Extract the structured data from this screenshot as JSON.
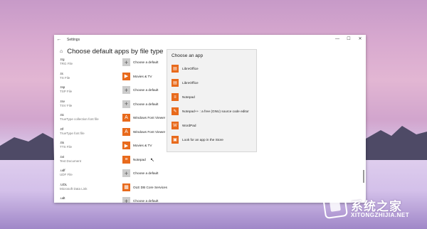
{
  "window": {
    "title": "Settings",
    "back_icon": "back-arrow-icon",
    "minimize": "—",
    "maximize": "☐",
    "close": "✕"
  },
  "heading": {
    "icon": "home-icon",
    "text": "Choose default apps by file type"
  },
  "rows": [
    {
      "ext": ".trg",
      "desc": "TRG File",
      "app": "Choose a default",
      "icon": "plus"
    },
    {
      "ext": ".ts",
      "desc": "TS File",
      "app": "Movies & TV",
      "icon": "app"
    },
    {
      "ext": ".tsp",
      "desc": "TSP File",
      "app": "Choose a default",
      "icon": "plus"
    },
    {
      "ext": ".tsv",
      "desc": "TSV File",
      "app": "Choose a default",
      "icon": "plus"
    },
    {
      "ext": ".ttc",
      "desc": "TrueType collection font file",
      "app": "Windows Font Viewer",
      "icon": "app"
    },
    {
      "ext": ".ttf",
      "desc": "TrueType font file",
      "app": "Windows Font Viewer",
      "icon": "app"
    },
    {
      "ext": ".tts",
      "desc": "TTS File",
      "app": "Movies & TV",
      "icon": "app"
    },
    {
      "ext": ".txt",
      "desc": "Text Document",
      "app": "Notepad",
      "icon": "app"
    },
    {
      "ext": ".udf",
      "desc": "UDF File",
      "app": "Choose a default",
      "icon": "plus"
    },
    {
      "ext": ".UDL",
      "desc": "Microsoft Data Link",
      "app": "OLE DB Core Services",
      "icon": "app"
    },
    {
      "ext": ".udt",
      "desc": "",
      "app": "Choose a default",
      "icon": "plus"
    }
  ],
  "flyout": {
    "title": "Choose an app",
    "items": [
      {
        "label": "LibreOffice",
        "icon": "libreoffice-icon"
      },
      {
        "label": "LibreOffice",
        "icon": "libreoffice-icon"
      },
      {
        "label": "Notepad",
        "icon": "notepad-icon"
      },
      {
        "label": "Notepad++ : a free (GNU) source code editor",
        "icon": "notepadpp-icon"
      },
      {
        "label": "WordPad",
        "icon": "wordpad-icon"
      },
      {
        "label": "Look for an app in the Store",
        "icon": "store-icon"
      }
    ]
  },
  "watermark": {
    "name": "系统之家",
    "url": "XITONGZHIJIA.NET"
  },
  "colors": {
    "accent": "#e86a1c",
    "plus_tile": "#cccccc"
  }
}
